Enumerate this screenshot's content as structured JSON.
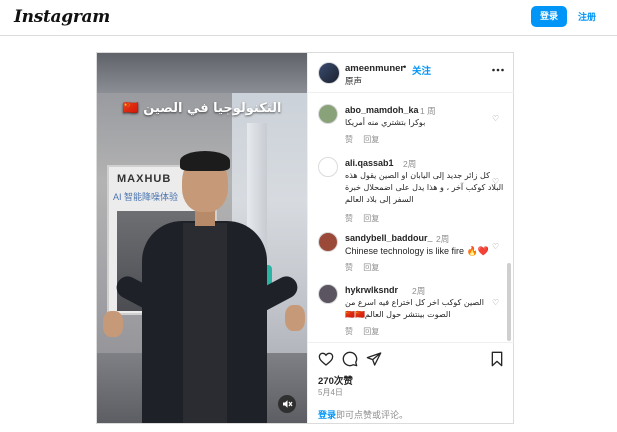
{
  "header": {
    "logo": "Instagram",
    "login_label": "登录",
    "signup_label": "注册"
  },
  "post": {
    "overlay_title": "التكنولوجيا في الصين",
    "flag_emoji": "🇨🇳",
    "booth_sign": "MAXHUB",
    "booth_sub": "AI 智能降噪体验",
    "author": {
      "username": "ameenmuner",
      "separator": "•",
      "follow_label": "关注",
      "audio_label": "原声"
    },
    "comments": [
      {
        "username": "abo_mamdoh_ka",
        "time": "1 周",
        "text": "بوكرا بتشتري منه أمريكا",
        "like_label": "赞",
        "reply_label": "回复",
        "avatar_color": "#8aa27a"
      },
      {
        "username": "ali.qassab1",
        "time": "2周",
        "text": "كل زائر جديد إلى اليابان او الصين يقول هذه البلاد كوكب آخر ، و هذا يدل على اضمحلال خبرة السفر إلى بلاد العالم",
        "like_label": "赞",
        "reply_label": "回复",
        "avatar_color": "#ffffff"
      },
      {
        "username": "sandybell_baddour_",
        "time": "2周",
        "text": "Chinese technology is like fire 🔥❤️",
        "like_label": "赞",
        "reply_label": "回复",
        "avatar_color": "#9b4a3a"
      },
      {
        "username": "hykrwlksndr",
        "time": "2周",
        "text": "الصين كوكب اخر كل اختراع فيه اسرع من الصوت بينتشر حول العالم🇨🇳🇨🇳",
        "like_label": "赞",
        "reply_label": "回复",
        "avatar_color": "#5a5560"
      }
    ],
    "likes": "270次赞",
    "date": "5月4日",
    "login_prompt_link": "登录",
    "login_prompt_rest": "即可点赞或评论。"
  }
}
